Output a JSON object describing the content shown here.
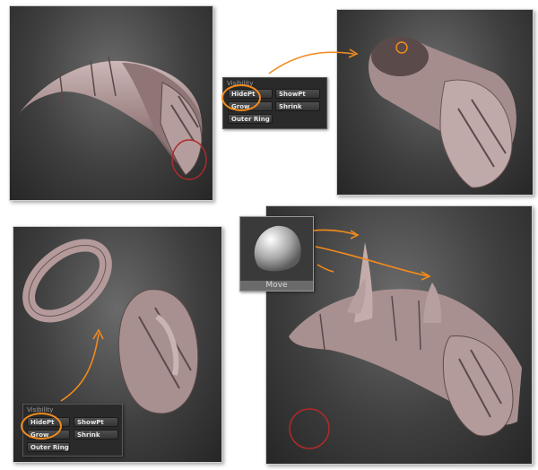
{
  "visibility_palette": {
    "title": "Visibility",
    "hide_pt": "HidePt",
    "show_pt": "ShowPt",
    "grow": "Grow",
    "shrink": "Shrink",
    "outer_ring": "Outer Ring"
  },
  "move_brush": {
    "label": "Move"
  },
  "colors": {
    "highlight": "#f28a1c",
    "red_circle": "#b02a2a",
    "clay": "#a89090"
  }
}
